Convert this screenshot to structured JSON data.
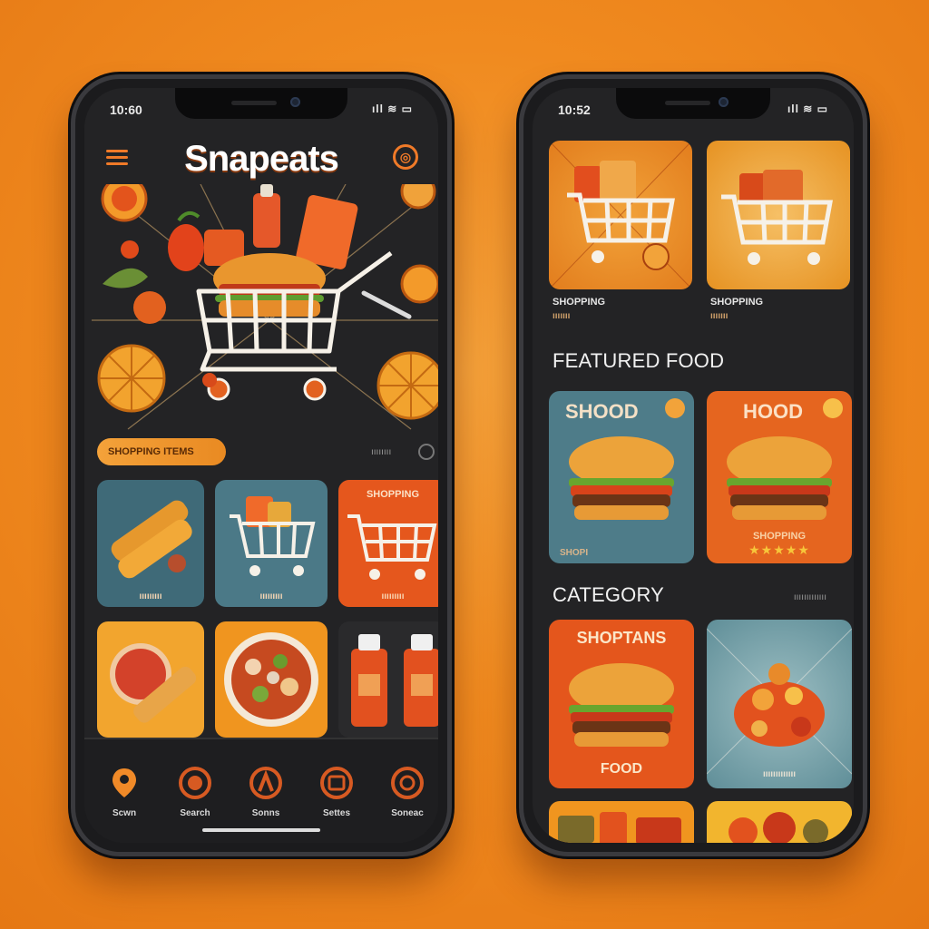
{
  "left_screen": {
    "status": {
      "time": "10:60",
      "icons": "ıll ≋ ▭"
    },
    "app_title": "Snapeats",
    "promo": {
      "label": "SHOPPING ITEMS",
      "meta": "ıııııııı"
    },
    "tiles_row1": [
      {
        "label": "ııııııııı"
      },
      {
        "label": "ııııııııı"
      },
      {
        "label": "ııııııııı",
        "top_label": "SHOPPING"
      }
    ],
    "tabs": [
      {
        "label": "Scwn",
        "icon": "location-icon"
      },
      {
        "label": "Search",
        "icon": "search-icon"
      },
      {
        "label": "Sonns",
        "icon": "deals-icon"
      },
      {
        "label": "Settes",
        "icon": "cart-icon"
      },
      {
        "label": "Soneac",
        "icon": "profile-icon"
      }
    ]
  },
  "right_screen": {
    "status": {
      "time": "10:52",
      "icons": "ıll ≋ ▭"
    },
    "shop_cards": [
      {
        "title": "SHOPPING",
        "subtitle": "ııııııı"
      },
      {
        "title": "SHOPPING",
        "subtitle": "ııııııı"
      }
    ],
    "featured_title": "FEATURED FOOD",
    "featured": [
      {
        "title": "SHOOD",
        "caption": "SHOPI"
      },
      {
        "title": "HOOD",
        "caption": "SHOPPING",
        "stars": 5
      }
    ],
    "category_title": "CATEGORY",
    "category_more": "ııııııııııııı",
    "categories": [
      {
        "title": "SHOPTANS",
        "caption": "FOOD"
      },
      {
        "caption": "ııııııııııııı"
      }
    ]
  },
  "colors": {
    "accent": "#f07a28",
    "background": "#f08a1f",
    "screen": "#232325"
  }
}
